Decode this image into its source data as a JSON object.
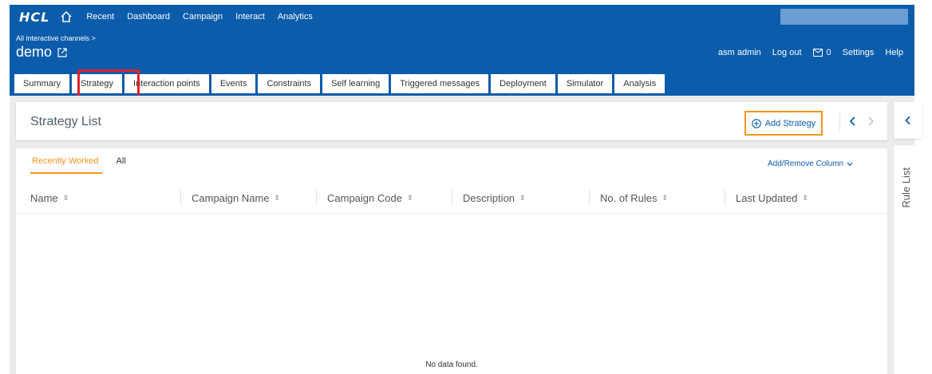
{
  "nav": {
    "logo": "HCL",
    "items": [
      "Recent",
      "Dashboard",
      "Campaign",
      "Interact",
      "Analytics"
    ],
    "search_placeholder": ""
  },
  "header": {
    "breadcrumb": "All interactive channels >",
    "title": "demo",
    "user": "asm admin",
    "logout": "Log out",
    "mail_count": "0",
    "settings": "Settings",
    "help": "Help"
  },
  "tabs": [
    {
      "label": "Summary"
    },
    {
      "label": "Strategy",
      "active": true
    },
    {
      "label": "Interaction points"
    },
    {
      "label": "Events"
    },
    {
      "label": "Constraints"
    },
    {
      "label": "Self learning"
    },
    {
      "label": "Triggered messages"
    },
    {
      "label": "Deployment"
    },
    {
      "label": "Simulator"
    },
    {
      "label": "Analysis"
    }
  ],
  "strategy_list": {
    "title": "Strategy List",
    "add_button": "Add Strategy",
    "sub_tabs": [
      {
        "label": "Recently Worked",
        "active": true
      },
      {
        "label": "All"
      }
    ],
    "add_remove_column": "Add/Remove Column",
    "columns": [
      "Name",
      "Campaign Name",
      "Campaign Code",
      "Description",
      "No. of Rules",
      "Last Updated"
    ],
    "sort_glyph": "⇕",
    "empty_message": "No data found."
  },
  "side_panel": {
    "label": "Rule List"
  },
  "colors": {
    "brand_blue": "#0b5cab",
    "accent_orange": "#f7941d",
    "highlight_red": "#d9232d"
  }
}
